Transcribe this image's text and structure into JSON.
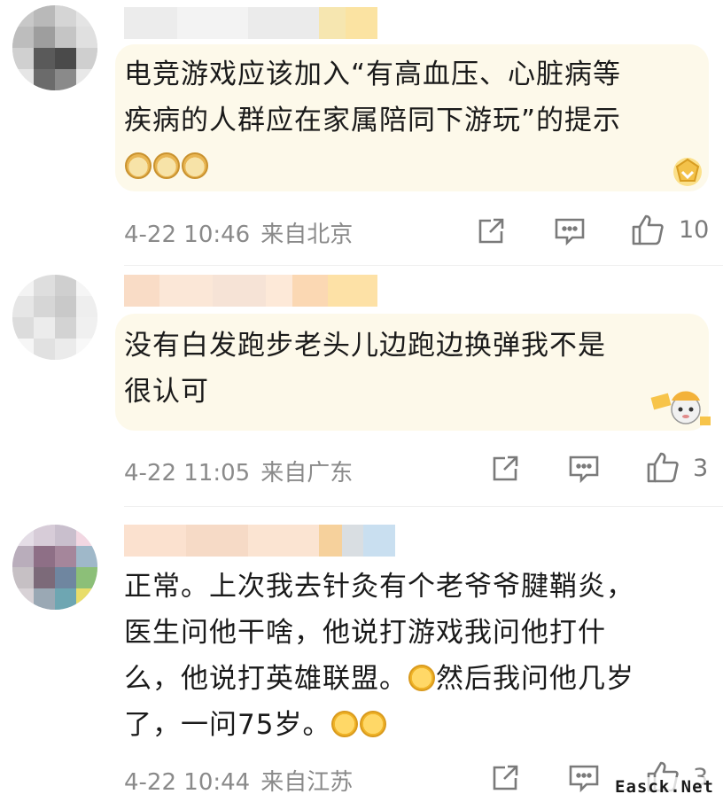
{
  "comments": [
    {
      "text_lines": [
        "电竞游戏应该加入“有高血压、心脏病等",
        "疾病的人群应在家属陪同下游玩”的提示"
      ],
      "emojis": [
        "doge",
        "doge",
        "doge"
      ],
      "date": "4-22 10:46",
      "location": "来自北京",
      "like_count": "10",
      "bubble_color": "#fdf9ea"
    },
    {
      "text_lines": [
        "没有白发跑步老头儿边跑边换弹我不是",
        "很认可"
      ],
      "date": "4-22 11:05",
      "location": "来自广东",
      "like_count": "3",
      "bubble_color": "#fdf9ea"
    },
    {
      "text_lines": [
        "正常。上次我去针灸有个老爷爷腱鞘炎，",
        "医生问他干啥，他说打游戏我问他打什",
        "么，他说打英雄联盟。",
        "然后我问他几岁",
        "了，一问75岁。"
      ],
      "date": "4-22 10:44",
      "location": "来自江苏",
      "like_count": "3"
    }
  ],
  "icons": {
    "share": "share-icon",
    "comment": "comment-icon",
    "like": "thumbs-up-icon",
    "emoji_doge": "doge-emoji-icon",
    "emoji_cry": "laugh-cry-emoji-icon"
  },
  "watermark": "Easck.Net",
  "colors": {
    "meta_text": "#8a8a8a",
    "icon": "#7a7a7a",
    "bubble": "#fdf9ea"
  }
}
